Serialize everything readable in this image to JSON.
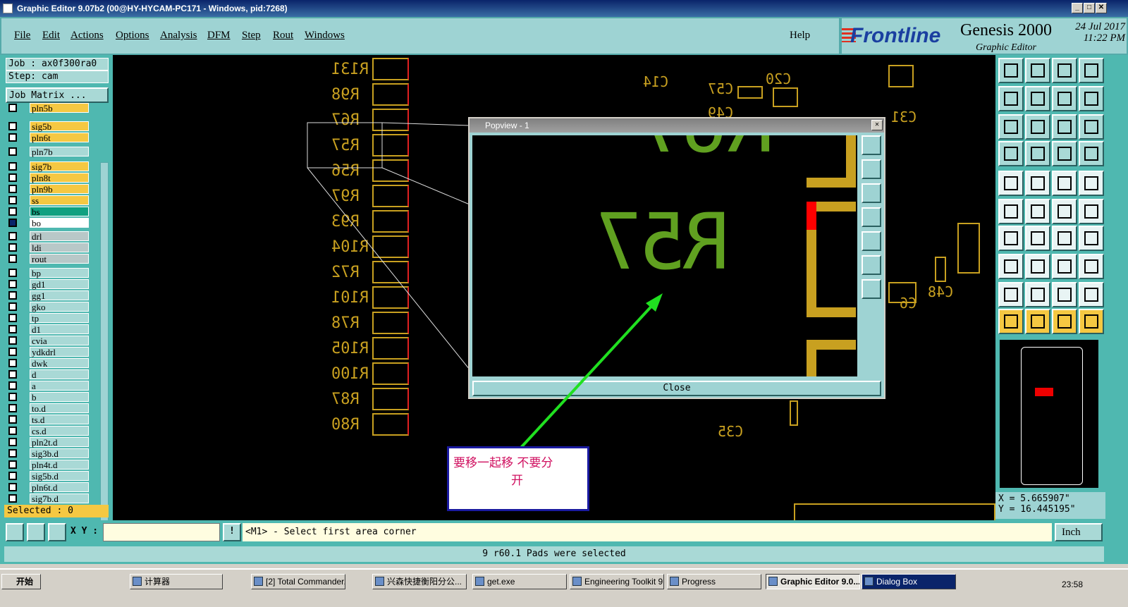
{
  "window": {
    "title": "Graphic Editor 9.07b2 (00@HY-HYCAM-PC171 - Windows, pid:7268)"
  },
  "menu": {
    "items": [
      "File",
      "Edit",
      "Actions",
      "Options",
      "Analysis",
      "DFM",
      "Step",
      "Rout",
      "Windows"
    ],
    "help": "Help"
  },
  "brand": {
    "logo": "Frontline",
    "product": "Genesis 2000",
    "subtitle": "Graphic Editor",
    "date": "24 Jul 2017",
    "time": "11:22 PM"
  },
  "job": {
    "job_label": "Job : ax0f300ra0",
    "step_label": "Step: cam",
    "matrix_button": "Job Matrix ..."
  },
  "layers": [
    {
      "name": "pln5b",
      "color": "#f5c842"
    },
    {
      "name": "sig5b",
      "color": "#f5c842"
    },
    {
      "name": "pln6t",
      "color": "#f5c842"
    },
    {
      "name": "pln7b",
      "color": "#a9d9d6"
    },
    {
      "name": "sig7b",
      "color": "#f5c842"
    },
    {
      "name": "pln8t",
      "color": "#f5c842"
    },
    {
      "name": "pln9b",
      "color": "#f5c842"
    },
    {
      "name": "ss",
      "color": "#f5c842"
    },
    {
      "name": "bs",
      "color": "#10a080"
    },
    {
      "name": "bo",
      "color": "#ffffff"
    },
    {
      "name": "drl",
      "color": "#b8c8c8"
    },
    {
      "name": "ldi",
      "color": "#b8c8c8"
    },
    {
      "name": "rout",
      "color": "#b8c8c8"
    },
    {
      "name": "bp",
      "color": "#a9d9d6"
    },
    {
      "name": "gd1",
      "color": "#a9d9d6"
    },
    {
      "name": "gg1",
      "color": "#a9d9d6"
    },
    {
      "name": "gko",
      "color": "#a9d9d6"
    },
    {
      "name": "tp",
      "color": "#a9d9d6"
    },
    {
      "name": "d1",
      "color": "#a9d9d6"
    },
    {
      "name": "cvia",
      "color": "#a9d9d6"
    },
    {
      "name": "ydkdrl",
      "color": "#a9d9d6"
    },
    {
      "name": "dwk",
      "color": "#a9d9d6"
    },
    {
      "name": "d",
      "color": "#a9d9d6"
    },
    {
      "name": "a",
      "color": "#a9d9d6"
    },
    {
      "name": "b",
      "color": "#a9d9d6"
    },
    {
      "name": "to.d",
      "color": "#a9d9d6"
    },
    {
      "name": "ts.d",
      "color": "#a9d9d6"
    },
    {
      "name": "cs.d",
      "color": "#a9d9d6"
    },
    {
      "name": "pln2t.d",
      "color": "#a9d9d6"
    },
    {
      "name": "sig3b.d",
      "color": "#a9d9d6"
    },
    {
      "name": "pln4t.d",
      "color": "#a9d9d6"
    },
    {
      "name": "sig5b.d",
      "color": "#a9d9d6"
    },
    {
      "name": "pln6t.d",
      "color": "#a9d9d6"
    },
    {
      "name": "sig7b.d",
      "color": "#a9d9d6"
    }
  ],
  "selected_label": "Selected : 0",
  "canvas": {
    "refdes": [
      "R131",
      "R98",
      "R67",
      "R57",
      "R56",
      "R97",
      "R93",
      "R104",
      "R72",
      "R101",
      "R78",
      "R105",
      "R100",
      "R87",
      "R80"
    ],
    "others": [
      "C14",
      "C57",
      "C20",
      "C49",
      "C31",
      "C48",
      "C6",
      "C35"
    ]
  },
  "popview": {
    "title": "Popview - 1",
    "zoom_text": "R57",
    "close_label": "Close"
  },
  "note": {
    "line1": "要移一起移  不要分",
    "line2": "开"
  },
  "coords": {
    "x": "X = 5.665907\"",
    "y": "Y = 16.445195\""
  },
  "cmd": {
    "xy_label": "X Y :",
    "prompt": "<M1> - Select first area corner",
    "unit": "Inch"
  },
  "status": "9 r60.1 Pads were selected",
  "taskbar": {
    "start": "开始",
    "tasks": [
      "计算器",
      "[2] Total Commander...",
      "兴森快捷衡阳分公...",
      "get.exe",
      "Engineering Toolkit 9...",
      "Progress",
      "Graphic Editor 9.0...",
      "Dialog Box"
    ],
    "clock": "23:58"
  }
}
